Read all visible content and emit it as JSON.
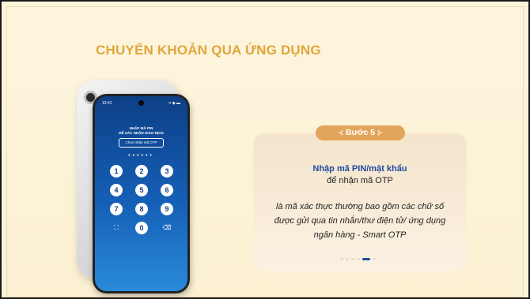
{
  "slide": {
    "title": "CHUYỂN KHOẢN QUA ỨNG DỤNG"
  },
  "phone": {
    "time": "19:41",
    "signal": "▪▪ ◆ ▬",
    "pin_title_line1": "NHẬP MÃ PIN",
    "pin_title_line2": "ĐỂ XÁC NHẬN GIAO DỊCH",
    "otp_button": "Chọn nhận mã OTP",
    "pin_dots": "••••••",
    "keys": [
      "1",
      "2",
      "3",
      "4",
      "5",
      "6",
      "7",
      "8",
      "9",
      "0"
    ],
    "face_id_icon": "face-id-icon",
    "backspace_icon": "backspace-icon"
  },
  "step": {
    "label": "Bước 5",
    "title": "Nhập mã PIN/mật khẩu",
    "subtitle": "để nhận mã OTP",
    "description": "là mã xác thực thường bao gồm các chữ số được gửi qua tin nhắn/thư điện tử/ ứng dụng ngân hàng - Smart OTP"
  },
  "pager": {
    "total": 6,
    "active": 5
  },
  "colors": {
    "title": "#e0a63b",
    "accent": "#1f4aa0",
    "pill": "#e3a55a"
  }
}
